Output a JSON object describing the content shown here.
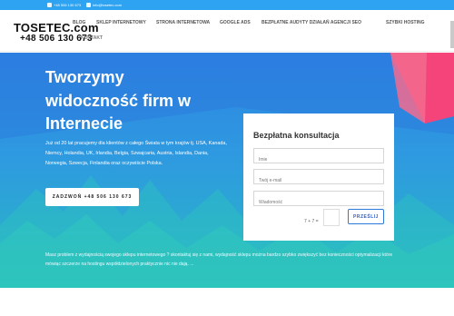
{
  "topbar": {
    "phone": "+48 506 130 673",
    "email": "info@tosetec.com"
  },
  "header": {
    "logo": "TOSETEC.com",
    "phone": "+48 506 130 673",
    "nav": [
      "BLOG",
      "SKLEP INTERNETOWY",
      "STRONA INTERNETOWA",
      "GOOGLE ADS",
      "BEZPŁATNE AUDYTY DZIAŁAŃ AGENCJI SEO",
      "SZYBKI HOSTING"
    ],
    "nav_second_row": "KONTAKT"
  },
  "hero": {
    "headline_lines": [
      "Tworzymy",
      "widoczność firm w",
      "Internecie"
    ],
    "lead": "Już od 20 lat pracujemy dla klientów z całego Świata w tym krajów tj. USA, Kanada, Niemcy, Holandia, UK, Irlandia, Belgia, Szwajcaria, Austria, Islandia, Dania, Norwegia, Szwecja, Finlandia oraz oczywiście Polska.",
    "call_button": "ZADZWOŃ +48 506 130 673",
    "note": "Masz problem z wydajnością swojego sklepu internetowego ? skontaktuj się z nami, wydajność sklepu można bardzo szybko zwiększyć bez konieczności optymalizacji które mówiąc szczerze na hostingu współdzielonych praktycznie nic nie dają. ..."
  },
  "form": {
    "title": "Bezpłatna konsultacja",
    "name_placeholder": "Imie",
    "email_placeholder": "Twój e-mail",
    "message_placeholder": "Wiadomość",
    "captcha_question": "7 + 7 =",
    "submit_label": "PRZEŚLIJ"
  },
  "colors": {
    "topbar": "#2ea3f2",
    "hero_top": "#2e83e3",
    "hero_bottom": "#29b9c2",
    "accent_pink": "#f5447a",
    "button_border": "#2d79d8"
  },
  "icons": [
    "phone-icon",
    "email-icon"
  ]
}
